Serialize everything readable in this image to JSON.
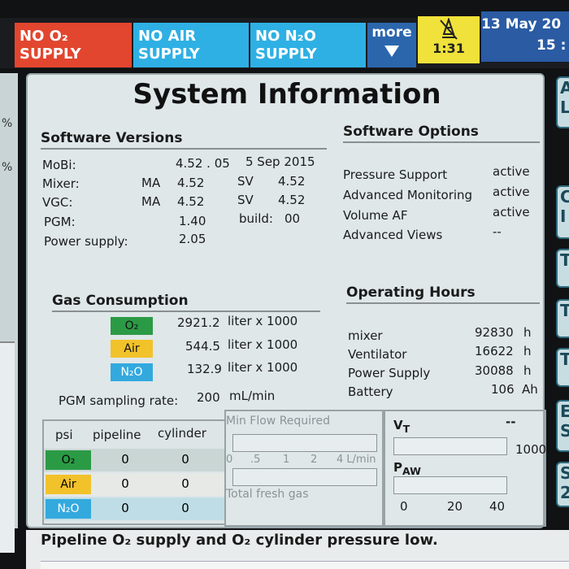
{
  "alarms": [
    {
      "line1": "NO O₂",
      "line2": "SUPPLY"
    },
    {
      "line1": "NO AIR",
      "line2": "SUPPLY"
    },
    {
      "line1": "NO N₂O",
      "line2": "SUPPLY"
    }
  ],
  "more_label": "more",
  "timer": "1:31",
  "date_line1": "13 May 20",
  "date_line2": "15 :",
  "left_units": [
    "%",
    "%"
  ],
  "title": "System Information",
  "software_versions": {
    "heading": "Software Versions",
    "rows": [
      {
        "name": "MoBi:",
        "a": "",
        "b": "4.52 . 05",
        "c": "5  Sep  2015",
        "d": ""
      },
      {
        "name": "Mixer:",
        "a": "MA",
        "b": "4.52",
        "c": "SV",
        "d": "4.52"
      },
      {
        "name": "VGC:",
        "a": "MA",
        "b": "4.52",
        "c": "SV",
        "d": "4.52"
      },
      {
        "name": "PGM:",
        "a": "",
        "b": "1.40",
        "c": "build:",
        "d": "00"
      },
      {
        "name": "Power supply:",
        "a": "",
        "b": "2.05",
        "c": "",
        "d": ""
      }
    ]
  },
  "software_options": {
    "heading": "Software Options",
    "rows": [
      {
        "name": "Pressure Support",
        "status": "active"
      },
      {
        "name": "Advanced Monitoring",
        "status": "active"
      },
      {
        "name": "Volume AF",
        "status": "active"
      },
      {
        "name": "Advanced Views",
        "status": "--"
      }
    ]
  },
  "gas_consumption": {
    "heading": "Gas Consumption",
    "rows": [
      {
        "gas": "O₂",
        "value": "2921.2",
        "unit": "liter x 1000"
      },
      {
        "gas": "Air",
        "value": "544.5",
        "unit": "liter x 1000"
      },
      {
        "gas": "N₂O",
        "value": "132.9",
        "unit": "liter x 1000"
      }
    ],
    "sampling_label": "PGM sampling rate:",
    "sampling_value": "200",
    "sampling_unit": "mL/min"
  },
  "operating_hours": {
    "heading": "Operating Hours",
    "rows": [
      {
        "name": "mixer",
        "value": "92830",
        "unit": "h"
      },
      {
        "name": "Ventilator",
        "value": "16622",
        "unit": "h"
      },
      {
        "name": "Power Supply",
        "value": "30088",
        "unit": "h"
      },
      {
        "name": "Battery",
        "value": "106",
        "unit": "Ah"
      }
    ]
  },
  "pressure_table": {
    "headers": [
      "psi",
      "pipeline",
      "cylinder"
    ],
    "rows": [
      {
        "gas": "O₂",
        "pipeline": "0",
        "cylinder": "0"
      },
      {
        "gas": "Air",
        "pipeline": "0",
        "cylinder": "0"
      },
      {
        "gas": "N₂O",
        "pipeline": "0",
        "cylinder": "0"
      }
    ]
  },
  "flow": {
    "min_flow_label": "Min Flow Required",
    "ticks": [
      "0",
      ".5",
      "1",
      "2",
      "4 L/min"
    ],
    "total_label": "Total fresh gas"
  },
  "vt": {
    "label": "V",
    "sub": "T",
    "value": "--",
    "max": "1000",
    "paw_label": "P",
    "paw_sub": "AW",
    "ticks": [
      "0",
      "20",
      "40"
    ]
  },
  "right_tabs": [
    "A\nL",
    "C\nI",
    "T",
    "T",
    "T",
    "E\nS",
    "S\n2"
  ],
  "message": "Pipeline O₂ supply and O₂ cylinder pressure low.",
  "colors": {
    "red_alarm": "#e2462f",
    "blue_alarm": "#2fb0e4",
    "o2": "#2b9a45",
    "air": "#f1c22a",
    "n2o": "#33a9de"
  }
}
